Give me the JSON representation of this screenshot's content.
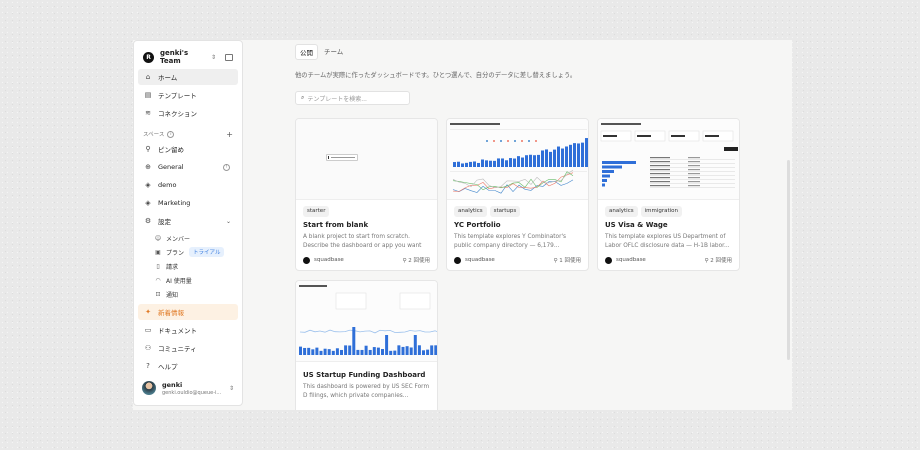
{
  "sidebar": {
    "team_name": "genki's Team",
    "nav": [
      {
        "label": "ホーム",
        "icon": "home-icon"
      },
      {
        "label": "テンプレート",
        "icon": "template-icon"
      },
      {
        "label": "コネクション",
        "icon": "database-icon"
      }
    ],
    "spaces_label": "スペース",
    "spaces": [
      {
        "label": "ピン留め",
        "icon": "pin-icon"
      },
      {
        "label": "General",
        "icon": "globe-icon"
      },
      {
        "label": "demo",
        "icon": "cube-icon"
      },
      {
        "label": "Marketing",
        "icon": "cube-icon"
      }
    ],
    "settings_label": "設定",
    "settings_items": [
      {
        "label": "メンバー",
        "icon": "user-icon"
      },
      {
        "label": "プラン",
        "icon": "plan-icon",
        "badge": "トライアル"
      },
      {
        "label": "請求",
        "icon": "receipt-icon"
      },
      {
        "label": "AI 使用量",
        "icon": "gauge-icon"
      },
      {
        "label": "通知",
        "icon": "inbox-icon"
      }
    ],
    "news_label": "新着情報",
    "bottom_nav": [
      {
        "label": "ドキュメント",
        "icon": "document-icon"
      },
      {
        "label": "コミュニティ",
        "icon": "community-icon"
      },
      {
        "label": "ヘルプ",
        "icon": "help-icon"
      }
    ],
    "user": {
      "name": "genki",
      "email": "genki.ouldio@queue-i..."
    }
  },
  "main": {
    "tabs": [
      "公開",
      "チーム"
    ],
    "description": "他のチームが実際に作ったダッシュボードです。ひとつ選んで、自分のデータに差し替えましょう。",
    "search_placeholder": "テンプレートを検索...",
    "cards": [
      {
        "tags": [
          "starter"
        ],
        "title": "Start from blank",
        "description": "A blank project to start from scratch. Describe the dashboard or app you want i...",
        "author": "squadbase",
        "uses": "2 回使用"
      },
      {
        "tags": [
          "analytics",
          "startups"
        ],
        "title": "YC Portfolio",
        "description": "This template explores Y Combinator's public company directory — 6,179...",
        "author": "squadbase",
        "uses": "1 回使用"
      },
      {
        "tags": [
          "analytics",
          "immigration"
        ],
        "title": "US Visa & Wage",
        "description": "This template explores US Department of Labor OFLC disclosure data — H-1B labor...",
        "author": "squadbase",
        "uses": "2 回使用"
      },
      {
        "tags": [],
        "title": "US Startup Funding Dashboard",
        "description": "This dashboard is powered by US SEC Form D filings, which private companies...",
        "author": "",
        "uses": ""
      }
    ]
  },
  "colors": {
    "accent_orange": "#e07a26",
    "trial_blue": "#3b7ee0",
    "chart_blue": "#2f6fd8"
  }
}
